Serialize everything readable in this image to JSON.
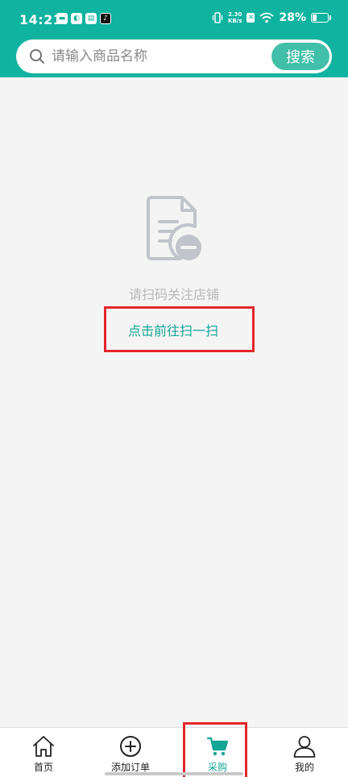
{
  "status_bar": {
    "time": "14:21",
    "net_speed_value": "2.30",
    "net_speed_unit": "KB/s",
    "battery_percent": "28%",
    "battery_level": 0.28
  },
  "search": {
    "placeholder": "请输入商品名称",
    "button_label": "搜索"
  },
  "empty_state": {
    "message": "请扫码关注店铺",
    "action_label": "点击前往扫一扫"
  },
  "bottom_nav": {
    "items": [
      {
        "label": "首页",
        "icon": "home-icon"
      },
      {
        "label": "添加订单",
        "icon": "plus-circle-icon"
      },
      {
        "label": "采购",
        "icon": "cart-icon",
        "active": true
      },
      {
        "label": "我的",
        "icon": "person-icon"
      }
    ]
  },
  "colors": {
    "brand": "#0fb3a0",
    "accent_text": "#13a595",
    "highlight_box": "#e3262b"
  }
}
